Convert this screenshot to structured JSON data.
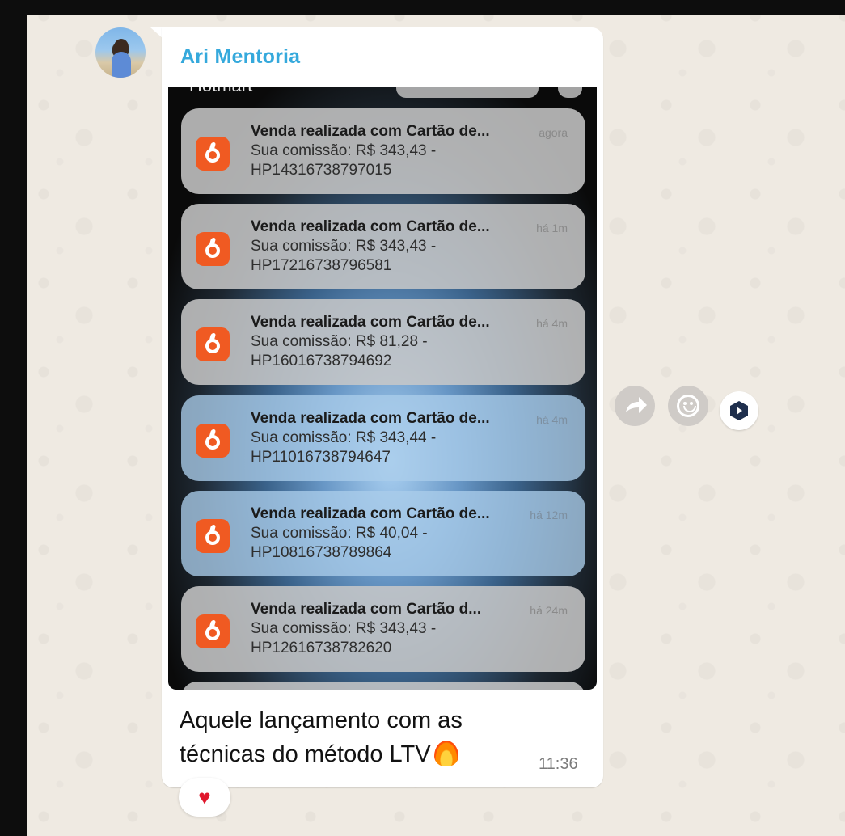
{
  "chat": {
    "sender_name": "Ari Mentoria",
    "caption": "Aquele lançamento com as técnicas do método LTV",
    "time": "11:36",
    "reaction": "♥"
  },
  "screenshot": {
    "app_label": "Hotmart",
    "notifications": [
      {
        "title": "Venda realizada com Cartão de...",
        "time": "agora",
        "line2": "Sua comissão: R$ 343,43 -",
        "line3": "HP14316738797015"
      },
      {
        "title": "Venda realizada com Cartão de...",
        "time": "há 1m",
        "line2": "Sua comissão: R$ 343,43 -",
        "line3": "HP17216738796581"
      },
      {
        "title": "Venda realizada com Cartão de...",
        "time": "há 4m",
        "line2": "Sua comissão: R$ 81,28 -",
        "line3": "HP16016738794692"
      },
      {
        "title": "Venda realizada com Cartão de...",
        "time": "há 4m",
        "line2": "Sua comissão: R$ 343,44 -",
        "line3": "HP11016738794647"
      },
      {
        "title": "Venda realizada com Cartão de...",
        "time": "há 12m",
        "line2": "Sua comissão: R$ 40,04 -",
        "line3": "HP10816738789864"
      },
      {
        "title": "Venda realizada com Cartão d...",
        "time": "há 24m",
        "line2": "Sua comissão: R$ 343,43 -",
        "line3": "HP12616738782620"
      }
    ]
  },
  "actions": {
    "forward_icon": "forward-arrow-icon",
    "emoji_icon": "smiley-icon",
    "extension_icon": "hexagon-extension-icon"
  },
  "colors": {
    "chat_background": "#efeae2",
    "sender_name": "#35a9dc",
    "app_icon": "#f05a22",
    "reaction_heart": "#e0182d"
  }
}
